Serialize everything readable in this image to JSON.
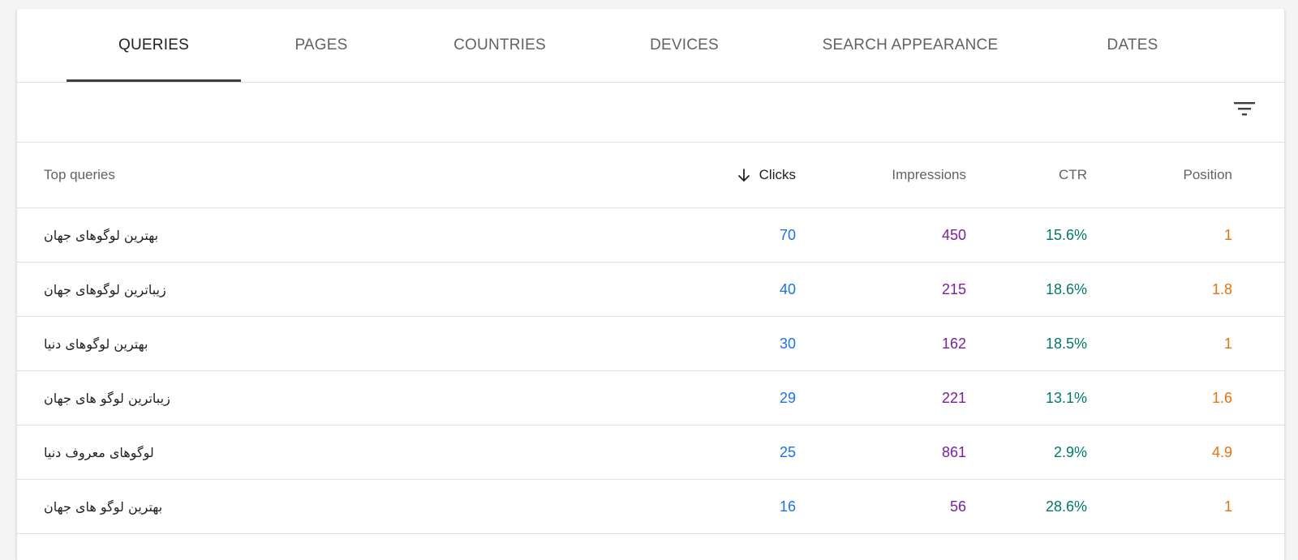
{
  "tabs": [
    {
      "label": "QUERIES",
      "active": true
    },
    {
      "label": "PAGES",
      "active": false
    },
    {
      "label": "COUNTRIES",
      "active": false
    },
    {
      "label": "DEVICES",
      "active": false
    },
    {
      "label": "SEARCH APPEARANCE",
      "active": false
    },
    {
      "label": "DATES",
      "active": false
    }
  ],
  "filter": {
    "icon": "filter-icon"
  },
  "table": {
    "headers": {
      "query": "Top queries",
      "clicks": "Clicks",
      "impressions": "Impressions",
      "ctr": "CTR",
      "position": "Position"
    },
    "sort": {
      "column": "clicks",
      "direction": "descending",
      "icon": "arrow-down-icon"
    },
    "rows": [
      {
        "query": "بهترین لوگوهای جهان",
        "clicks": "70",
        "impressions": "450",
        "ctr": "15.6%",
        "position": "1"
      },
      {
        "query": "زیباترین لوگوهای جهان",
        "clicks": "40",
        "impressions": "215",
        "ctr": "18.6%",
        "position": "1.8"
      },
      {
        "query": "بهترین لوگوهای دنیا",
        "clicks": "30",
        "impressions": "162",
        "ctr": "18.5%",
        "position": "1"
      },
      {
        "query": "زیباترین لوگو های جهان",
        "clicks": "29",
        "impressions": "221",
        "ctr": "13.1%",
        "position": "1.6"
      },
      {
        "query": "لوگوهای معروف دنیا",
        "clicks": "25",
        "impressions": "861",
        "ctr": "2.9%",
        "position": "4.9"
      },
      {
        "query": "بهترین لوگو های جهان",
        "clicks": "16",
        "impressions": "56",
        "ctr": "28.6%",
        "position": "1"
      }
    ]
  },
  "colors": {
    "clicks": "#1a73e8",
    "impressions": "#7b1fa2",
    "ctr": "#00796b",
    "position": "#e8710a"
  }
}
